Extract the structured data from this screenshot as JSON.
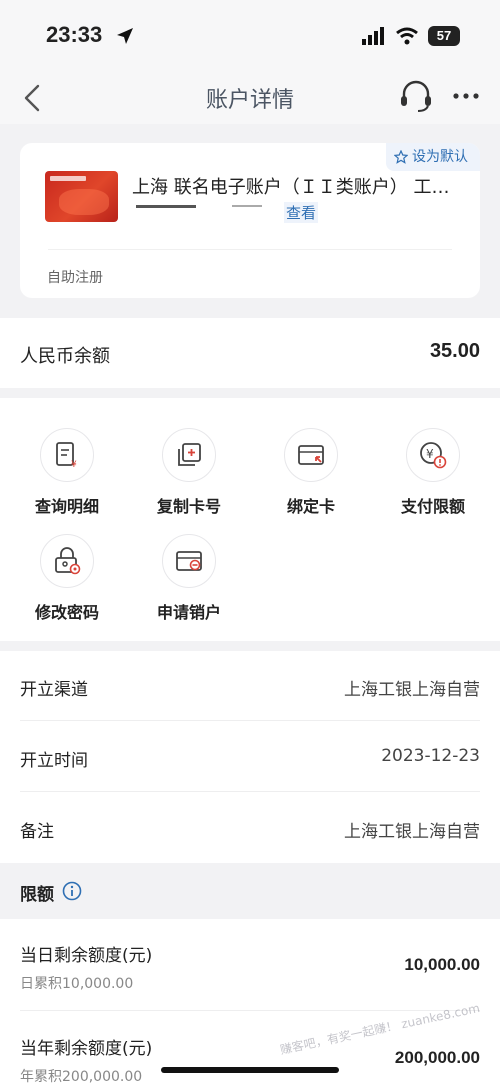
{
  "status_bar": {
    "time": "23:33",
    "battery": "57"
  },
  "nav": {
    "title": "账户详情"
  },
  "account_card": {
    "default_badge": "设为默认",
    "name": "上海 联名电子账户（ＩＩ类账户） 工银...",
    "view_link": "查看",
    "note": "自助注册"
  },
  "balance": {
    "label": "人民币余额",
    "value": "35.00"
  },
  "actions": [
    {
      "label": "查询明细",
      "icon": "detail-icon"
    },
    {
      "label": "复制卡号",
      "icon": "copy-card-icon"
    },
    {
      "label": "绑定卡",
      "icon": "bind-card-icon"
    },
    {
      "label": "支付限额",
      "icon": "payment-limit-icon"
    },
    {
      "label": "修改密码",
      "icon": "change-password-icon"
    },
    {
      "label": "申请销户",
      "icon": "close-account-icon"
    }
  ],
  "info": [
    {
      "label": "开立渠道",
      "value": "上海工银上海自营"
    },
    {
      "label": "开立时间",
      "value": "2023-12-23"
    },
    {
      "label": "备注",
      "value": "上海工银上海自营"
    }
  ],
  "limits": {
    "title": "限额",
    "rows": [
      {
        "label": "当日剩余额度(元)",
        "sub": "日累积10,000.00",
        "value": "10,000.00"
      },
      {
        "label": "当年剩余额度(元)",
        "sub": "年累积200,000.00",
        "value": "200,000.00"
      }
    ]
  },
  "watermark": "赚客吧，有奖一起赚！ zuanke8.com",
  "colors": {
    "accent": "#2f6fb3",
    "card_red": "#c8281e",
    "icon_red": "#d9443a"
  }
}
